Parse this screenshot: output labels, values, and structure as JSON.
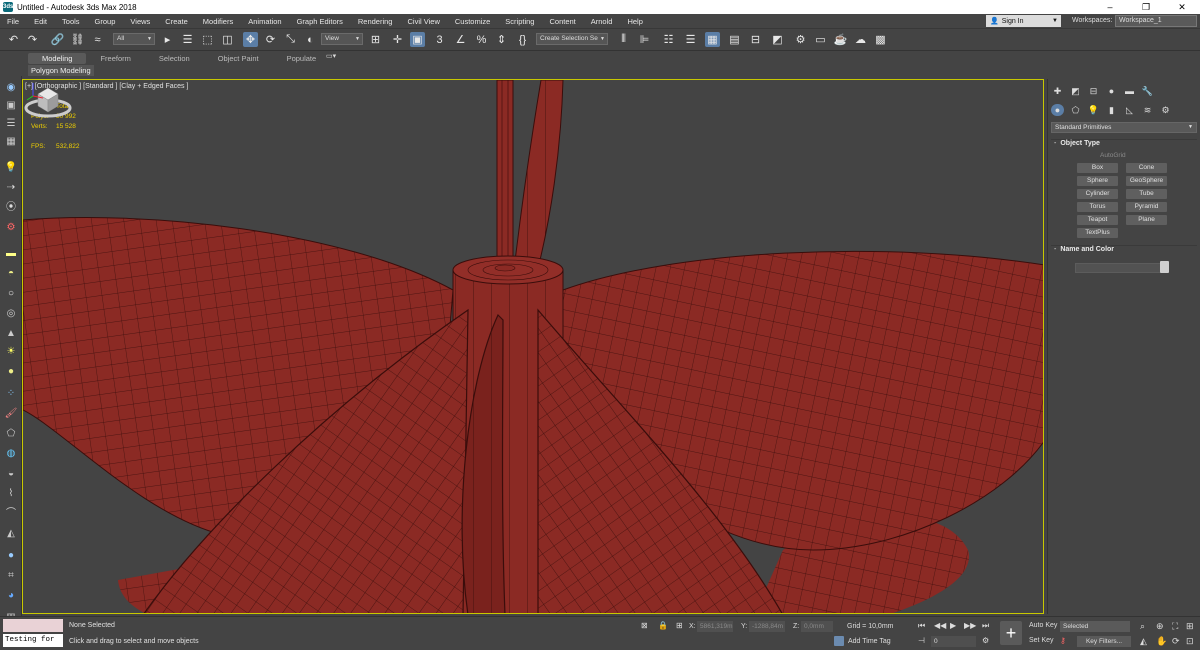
{
  "window": {
    "title": "Untitled - Autodesk 3ds Max 2018",
    "app_icon": "3ds",
    "controls": [
      "–",
      "❐",
      "✕"
    ]
  },
  "menu": [
    "File",
    "Edit",
    "Tools",
    "Group",
    "Views",
    "Create",
    "Modifiers",
    "Animation",
    "Graph Editors",
    "Rendering",
    "Civil View",
    "Customize",
    "Scripting",
    "Content",
    "Arnold",
    "Help"
  ],
  "account": {
    "sign_in": "Sign In",
    "workspaces_label": "Workspaces:",
    "workspace": "Workspace_1"
  },
  "toolbar": {
    "filter": "All",
    "ref_coord": "View",
    "selection_set": "Create Selection Se",
    "snap_angle": "3",
    "icons": [
      "undo-icon",
      "redo-icon",
      "link-icon",
      "unlink-icon",
      "bind-space-warp-icon",
      "select-object-icon",
      "select-by-name-icon",
      "rect-selection-icon",
      "window-crossing-icon",
      "move-icon",
      "rotate-icon",
      "scale-icon",
      "placement-icon",
      "pivot-icon",
      "keyboard-shortcut-icon",
      "snaps-toggle-icon",
      "angle-snap-icon",
      "percent-snap-icon",
      "spinner-snap-icon",
      "edit-named-sets-icon",
      "mirror-icon",
      "align-icon",
      "toggle-scene-explorer-icon",
      "toggle-layer-explorer-icon",
      "toggle-ribbon-icon",
      "curve-editor-icon",
      "schematic-view-icon",
      "material-editor-icon",
      "render-setup-icon",
      "rendered-frame-window-icon",
      "render-icon",
      "render-cloud-icon",
      "a360-gallery-icon"
    ]
  },
  "ribbon": {
    "tabs": [
      "Modeling",
      "Freeform",
      "Selection",
      "Object Paint",
      "Populate"
    ],
    "active_tab": "Modeling",
    "subtab": "Polygon Modeling",
    "options_icon": "ribbon-options-icon"
  },
  "viewport": {
    "label": "[+] [Orthographic ] [Standard ] [Clay + Edged Faces ]",
    "stats": {
      "total_label": "Total",
      "polys_label": "Polys:",
      "polys": "30 992",
      "verts_label": "Verts:",
      "verts": "15 528",
      "fps_label": "FPS:",
      "fps": "532,822"
    },
    "model_color": "#8b2a24",
    "edge_color": "#3a0d0b",
    "border_color": "#c8c800"
  },
  "command_panel": {
    "tab_icons": [
      "create-icon",
      "modify-icon",
      "hierarchy-icon",
      "motion-icon",
      "display-icon",
      "utilities-icon"
    ],
    "category_icons": [
      "geometry-icon",
      "shapes-icon",
      "lights-icon",
      "cameras-icon",
      "helpers-icon",
      "space-warps-icon",
      "systems-icon"
    ],
    "primitive_type": "Standard Primitives",
    "object_type_title": "Object Type",
    "autogrid": "AutoGrid",
    "buttons": [
      "Box",
      "Cone",
      "Sphere",
      "GeoSphere",
      "Cylinder",
      "Tube",
      "Torus",
      "Pyramid",
      "Teapot",
      "Plane",
      "TextPlus"
    ],
    "name_color_title": "Name and Color"
  },
  "status": {
    "listener_text": "Testing for :",
    "selection": "None Selected",
    "prompt": "Click and drag to select and move objects",
    "x_label": "X:",
    "x_val": "5861,319m",
    "y_label": "Y:",
    "y_val": "-1288,84m",
    "z_label": "Z:",
    "z_val": "0,0mm",
    "grid": "Grid = 10,0mm",
    "add_time_tag": "Add Time Tag",
    "frame": "0",
    "auto_key": "Auto Key",
    "set_key": "Set Key",
    "selected_dropdown": "Selected",
    "key_filters": "Key Filters..."
  }
}
